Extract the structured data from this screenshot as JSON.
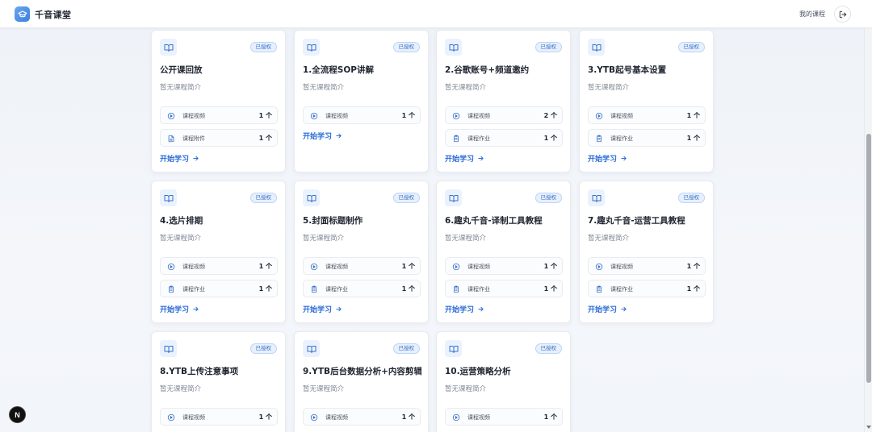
{
  "header": {
    "app_title": "千音课堂",
    "my_courses_label": "我的课程"
  },
  "card_common": {
    "badge_label": "已授权",
    "description": "暂无课程简介",
    "start_label": "开始学习"
  },
  "courses": [
    {
      "title": "公开课回放",
      "stats": [
        {
          "icon": "video-icon",
          "label": "课程视频",
          "count": "1 个"
        },
        {
          "icon": "file-icon",
          "label": "课程附件",
          "count": "1 个"
        }
      ]
    },
    {
      "title": "1.全流程SOP讲解",
      "stats": [
        {
          "icon": "video-icon",
          "label": "课程视频",
          "count": "1 个"
        }
      ]
    },
    {
      "title": "2.谷歌账号+频道邀约",
      "stats": [
        {
          "icon": "video-icon",
          "label": "课程视频",
          "count": "2 个"
        },
        {
          "icon": "clipboard-icon",
          "label": "课程作业",
          "count": "1 个"
        }
      ]
    },
    {
      "title": "3.YTB起号基本设置",
      "stats": [
        {
          "icon": "video-icon",
          "label": "课程视频",
          "count": "1 个"
        },
        {
          "icon": "clipboard-icon",
          "label": "课程作业",
          "count": "1 个"
        }
      ]
    },
    {
      "title": "4.选片排期",
      "stats": [
        {
          "icon": "video-icon",
          "label": "课程视频",
          "count": "1 个"
        },
        {
          "icon": "clipboard-icon",
          "label": "课程作业",
          "count": "1 个"
        }
      ]
    },
    {
      "title": "5.封面标题制作",
      "stats": [
        {
          "icon": "video-icon",
          "label": "课程视频",
          "count": "1 个"
        },
        {
          "icon": "clipboard-icon",
          "label": "课程作业",
          "count": "1 个"
        }
      ]
    },
    {
      "title": "6.趣丸千音-译制工具教程",
      "stats": [
        {
          "icon": "video-icon",
          "label": "课程视频",
          "count": "1 个"
        },
        {
          "icon": "clipboard-icon",
          "label": "课程作业",
          "count": "1 个"
        }
      ]
    },
    {
      "title": "7.趣丸千音-运营工具教程",
      "stats": [
        {
          "icon": "video-icon",
          "label": "课程视频",
          "count": "1 个"
        },
        {
          "icon": "clipboard-icon",
          "label": "课程作业",
          "count": "1 个"
        }
      ]
    },
    {
      "title": "8.YTB上传注意事项",
      "stats": [
        {
          "icon": "video-icon",
          "label": "课程视频",
          "count": "1 个"
        }
      ]
    },
    {
      "title": "9.YTB后台数据分析+内容剪辑",
      "stats": [
        {
          "icon": "video-icon",
          "label": "课程视频",
          "count": "1 个"
        }
      ]
    },
    {
      "title": "10.运营策略分析",
      "stats": [
        {
          "icon": "video-icon",
          "label": "课程视频",
          "count": "1 个"
        }
      ]
    }
  ],
  "next_badge": "N",
  "colors": {
    "accent": "#2b6cd6",
    "badge_bg": "#e7f0fd",
    "card_bg": "#ffffff"
  }
}
